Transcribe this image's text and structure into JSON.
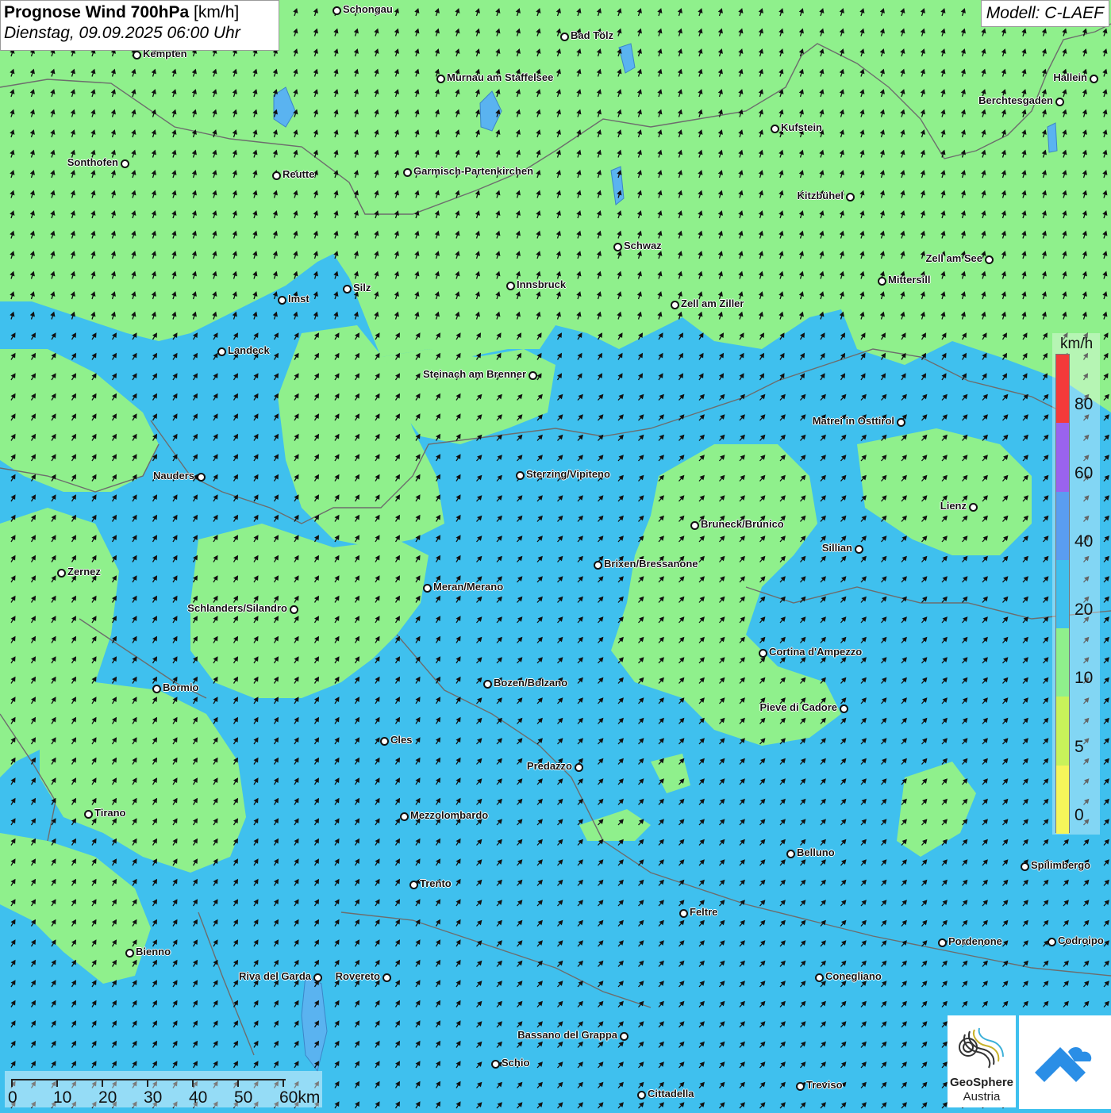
{
  "title": {
    "main": "Prognose Wind 700hPa",
    "unit": "[km/h]",
    "datetime": "Dienstag, 09.09.2025 06:00 Uhr"
  },
  "model": "Modell: C-LAEF",
  "legend": {
    "unit": "km/h",
    "ticks": [
      "0",
      "5",
      "10",
      "20",
      "40",
      "60",
      "80"
    ],
    "colors": [
      "#f5f55a",
      "#c8f25a",
      "#8ff08c",
      "#3fc0ee",
      "#5a9df0",
      "#9a63ee",
      "#f43a3a"
    ]
  },
  "colors": {
    "low_wind": "#8ff08c",
    "mid_wind": "#3fc0ee",
    "border": "#6d6d6d",
    "lakes": "#5ab3f0"
  },
  "scale_bar": {
    "labels": [
      "0",
      "10",
      "20",
      "30",
      "40",
      "50",
      "60km"
    ]
  },
  "cities": [
    {
      "name": "Schongau"
    },
    {
      "name": "Bad Tölz"
    },
    {
      "name": "Kempten"
    },
    {
      "name": "Murnau am Staffelsee"
    },
    {
      "name": "Hallein"
    },
    {
      "name": "Berchtesgaden"
    },
    {
      "name": "Kufstein"
    },
    {
      "name": "Sonthofen"
    },
    {
      "name": "Reutte"
    },
    {
      "name": "Garmisch-Partenkirchen"
    },
    {
      "name": "Kitzbühel"
    },
    {
      "name": "Schwaz"
    },
    {
      "name": "Zell am See"
    },
    {
      "name": "Mittersill"
    },
    {
      "name": "Imst"
    },
    {
      "name": "Silz"
    },
    {
      "name": "Innsbruck"
    },
    {
      "name": "Zell am Ziller"
    },
    {
      "name": "Landeck"
    },
    {
      "name": "Steinach am Brenner"
    },
    {
      "name": "Matrei in Osttirol"
    },
    {
      "name": "Nauders"
    },
    {
      "name": "Sterzing/Vipiteno"
    },
    {
      "name": "Lienz"
    },
    {
      "name": "Bruneck/Brunico"
    },
    {
      "name": "Sillian"
    },
    {
      "name": "Zernez"
    },
    {
      "name": "Brixen/Bressanone"
    },
    {
      "name": "Meran/Merano"
    },
    {
      "name": "Schlanders/Silandro"
    },
    {
      "name": "Cortina d'Ampezzo"
    },
    {
      "name": "Bormio"
    },
    {
      "name": "Bozen/Bolzano"
    },
    {
      "name": "Pieve di Cadore"
    },
    {
      "name": "Cles"
    },
    {
      "name": "Predazzo"
    },
    {
      "name": "Tirano"
    },
    {
      "name": "Mezzolombardo"
    },
    {
      "name": "Belluno"
    },
    {
      "name": "Spilimbergo"
    },
    {
      "name": "Trento"
    },
    {
      "name": "Feltre"
    },
    {
      "name": "Pordenone"
    },
    {
      "name": "Codroipo"
    },
    {
      "name": "Bienno"
    },
    {
      "name": "Riva del Garda"
    },
    {
      "name": "Rovereto"
    },
    {
      "name": "Conegliano"
    },
    {
      "name": "Bassano del Grappa"
    },
    {
      "name": "Schio"
    },
    {
      "name": "Treviso"
    },
    {
      "name": "Cittadella"
    }
  ],
  "logos": {
    "geosphere_name": "GeoSphere",
    "geosphere_sub": "Austria"
  }
}
